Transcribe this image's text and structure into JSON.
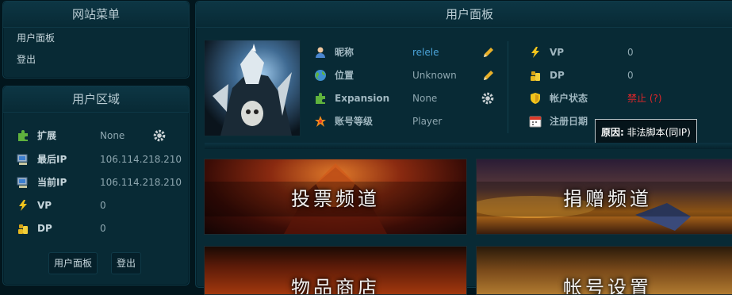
{
  "menu": {
    "title": "网站菜单",
    "items": [
      {
        "label": "用户面板"
      },
      {
        "label": "登出"
      }
    ]
  },
  "user_zone": {
    "title": "用户区域",
    "rows": [
      {
        "icon": "puzzle-icon",
        "label": "扩展",
        "value": "None"
      },
      {
        "icon": "computer-icon",
        "label": "最后IP",
        "value": "106.114.218.210"
      },
      {
        "icon": "computer-icon",
        "label": "当前IP",
        "value": "106.114.218.210"
      },
      {
        "icon": "lightning-icon",
        "label": "VP",
        "value": "0"
      },
      {
        "icon": "coins-icon",
        "label": "DP",
        "value": "0"
      }
    ],
    "buttons": {
      "panel": "用户面板",
      "logout": "登出"
    }
  },
  "user_panel": {
    "title": "用户面板",
    "left_info": [
      {
        "icon": "user-icon",
        "label": "昵称",
        "value": "relele",
        "action_icon": "pencil-icon"
      },
      {
        "icon": "globe-icon",
        "label": "位置",
        "value": "Unknown",
        "action_icon": "pencil-icon"
      },
      {
        "icon": "puzzle-icon",
        "label": "Expansion",
        "value": "None",
        "action_icon": "gear-icon"
      },
      {
        "icon": "star-icon",
        "label": "账号等级",
        "value": "Player"
      }
    ],
    "right_info": [
      {
        "icon": "lightning-icon",
        "label": "VP",
        "value": "0"
      },
      {
        "icon": "coins-icon",
        "label": "DP",
        "value": "0"
      },
      {
        "icon": "shield-icon",
        "label": "帐户状态",
        "value": "禁止 (?)"
      },
      {
        "icon": "calendar-icon",
        "label": "注册日期",
        "value": ""
      }
    ],
    "tooltip": {
      "label": "原因:",
      "text": "非法脚本(同IP)"
    },
    "banners": [
      {
        "title": "投票频道"
      },
      {
        "title": "捐赠频道"
      },
      {
        "title": "物品商店"
      },
      {
        "title": "帐号设置"
      }
    ]
  },
  "colors": {
    "status_banned": "#e0262a",
    "nickname_link": "#4aa3d8",
    "panel_bg": "#082a35"
  }
}
